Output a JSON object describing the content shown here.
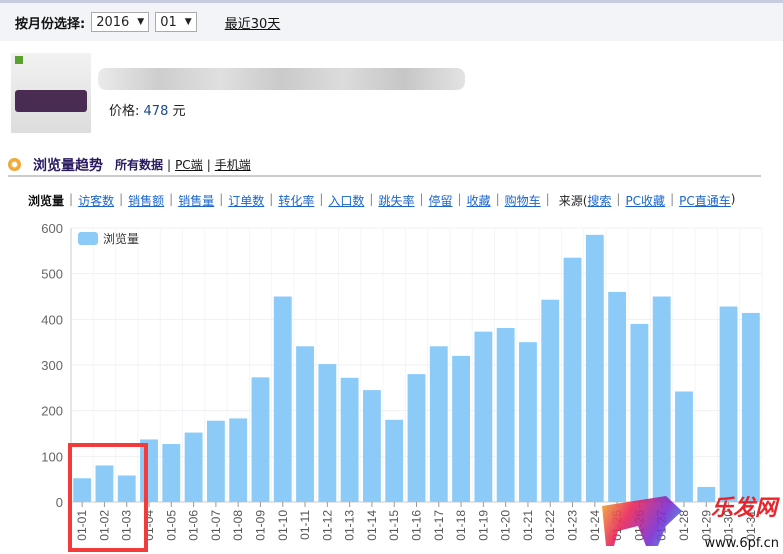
{
  "filter": {
    "label": "按月份选择:",
    "year": "2016",
    "month": "01",
    "recent_link": "最近30天"
  },
  "product": {
    "price_label": "价格:",
    "price_value": "478",
    "price_unit": "元"
  },
  "section": {
    "title": "浏览量趋势",
    "source_all": "所有数据",
    "source_pc": "PC端",
    "source_mobile": "手机端"
  },
  "metrics": [
    {
      "label": "浏览量",
      "active": true
    },
    {
      "label": "访客数"
    },
    {
      "label": "销售额"
    },
    {
      "label": "销售量"
    },
    {
      "label": "订单数"
    },
    {
      "label": "转化率"
    },
    {
      "label": "入口数"
    },
    {
      "label": "跳失率"
    },
    {
      "label": "停留"
    },
    {
      "label": "收藏"
    },
    {
      "label": "购物车"
    }
  ],
  "source": {
    "prefix": "来源(",
    "items": [
      "搜索",
      "PC收藏",
      "PC直通车"
    ],
    "suffix": ")"
  },
  "watermark": {
    "text": "乐发网",
    "url": "www.6pf.cn"
  },
  "chart_data": {
    "type": "bar",
    "legend": "浏览量",
    "legend_position": "top-left",
    "color": "#8ccaf7",
    "grid": true,
    "ylim": [
      0,
      600
    ],
    "yticks": [
      0,
      100,
      200,
      300,
      400,
      500,
      600
    ],
    "categories": [
      "01-01",
      "01-02",
      "01-03",
      "01-04",
      "01-05",
      "01-06",
      "01-07",
      "01-08",
      "01-09",
      "01-10",
      "01-11",
      "01-12",
      "01-13",
      "01-14",
      "01-15",
      "01-16",
      "01-17",
      "01-18",
      "01-19",
      "01-20",
      "01-21",
      "01-22",
      "01-23",
      "01-24",
      "01-25",
      "01-26",
      "01-27",
      "01-28",
      "01-29",
      "01-30",
      "01-31"
    ],
    "series": [
      {
        "name": "浏览量",
        "values": [
          52,
          80,
          58,
          137,
          127,
          152,
          178,
          183,
          273,
          450,
          341,
          302,
          272,
          245,
          180,
          280,
          341,
          320,
          373,
          381,
          350,
          443,
          535,
          585,
          460,
          390,
          450,
          242,
          33,
          428,
          414
        ]
      }
    ],
    "highlight": [
      "01-01",
      "01-02",
      "01-03"
    ]
  }
}
